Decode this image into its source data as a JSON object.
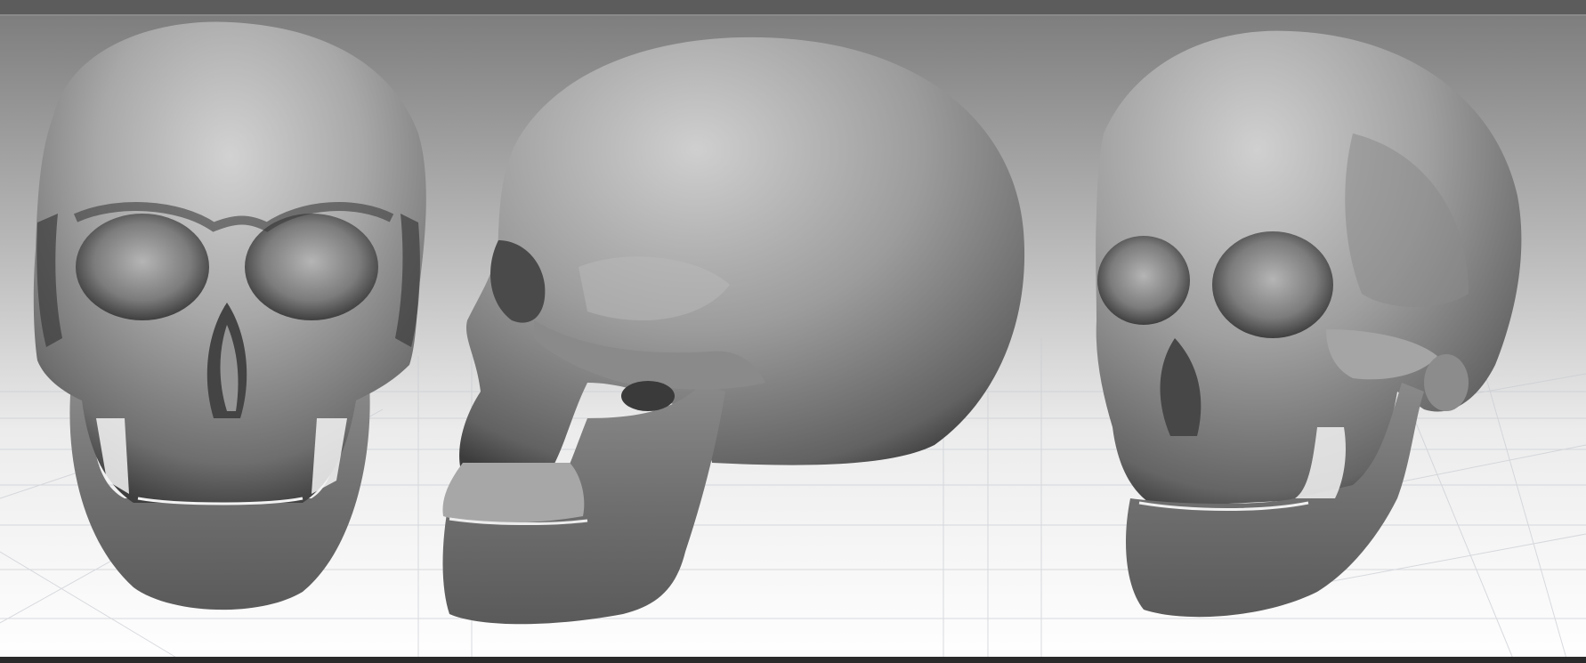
{
  "scene": {
    "views": [
      {
        "name": "front"
      },
      {
        "name": "side"
      },
      {
        "name": "three-quarter"
      }
    ]
  },
  "colors": {
    "background_top": "#777777",
    "background_bottom": "#ffffff",
    "bone_light": "#c9c9c9",
    "bone_mid": "#8e8e8e",
    "bone_dark": "#2e2e2e",
    "grid_line": "#c8ccd2",
    "top_bar": "#5c5c5c",
    "bottom_bar": "#2a2a2a"
  },
  "icons": [
    "skull-front-icon",
    "skull-side-icon",
    "skull-three-quarter-icon"
  ]
}
